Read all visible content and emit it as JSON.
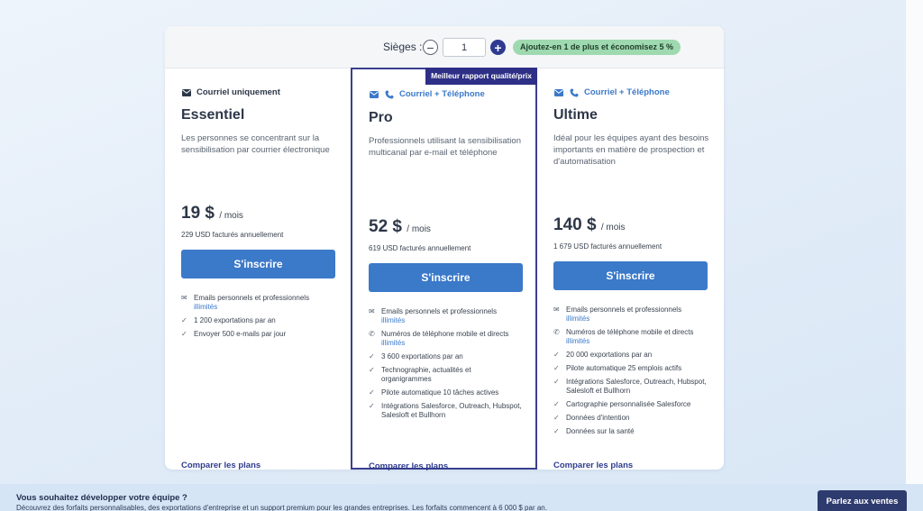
{
  "seats": {
    "label": "Sièges :",
    "value": "1",
    "minus": "−",
    "plus": "+",
    "badge": "Ajoutez-en 1 de plus et économisez 5 %"
  },
  "plans": [
    {
      "channel": "Courriel uniquement",
      "icons": [
        "envelope-icon"
      ],
      "name": "Essentiel",
      "description": "Les personnes se concentrant sur la sensibilisation par courrier électronique",
      "price": "19 $",
      "per": "/ mois",
      "billed": "229 USD facturés annuellement",
      "cta": "S'inscrire",
      "features": [
        {
          "icon": "envelope-icon",
          "text": "Emails personnels et professionnels",
          "highlight": "illimités"
        },
        {
          "icon": "check-icon",
          "text": "1 200 exportations par an",
          "highlight": ""
        },
        {
          "icon": "check-icon",
          "text": "Envoyer 500 e-mails par jour",
          "highlight": ""
        }
      ],
      "compare": "Comparer les plans"
    },
    {
      "ribbon": "Meilleur rapport qualité/prix",
      "channel": "Courriel + Téléphone",
      "icons": [
        "envelope-icon",
        "phone-icon"
      ],
      "name": "Pro",
      "description": "Professionnels utilisant la sensibilisation multicanal par e-mail et téléphone",
      "price": "52 $",
      "per": "/ mois",
      "billed": "619 USD facturés annuellement",
      "cta": "S'inscrire",
      "features": [
        {
          "icon": "envelope-icon",
          "text": "Emails personnels et professionnels",
          "highlight": "illimités"
        },
        {
          "icon": "phone-icon",
          "text": "Numéros de téléphone mobile et directs",
          "highlight": "illimités"
        },
        {
          "icon": "check-icon",
          "text": "3 600 exportations par an",
          "highlight": ""
        },
        {
          "icon": "check-icon",
          "text": "Technographie, actualités et organigrammes",
          "highlight": ""
        },
        {
          "icon": "check-icon",
          "text": "Pilote automatique 10 tâches actives",
          "highlight": ""
        },
        {
          "icon": "check-icon",
          "text": "Intégrations Salesforce, Outreach, Hubspot, Salesloft et Bullhorn",
          "highlight": ""
        }
      ],
      "compare": "Comparer les plans"
    },
    {
      "channel": "Courriel + Téléphone",
      "icons": [
        "envelope-icon",
        "phone-icon"
      ],
      "name": "Ultime",
      "description": "Idéal pour les équipes ayant des besoins importants en matière de prospection et d'automatisation",
      "price": "140 $",
      "per": "/ mois",
      "billed": "1 679 USD facturés annuellement",
      "cta": "S'inscrire",
      "features": [
        {
          "icon": "envelope-icon",
          "text": "Emails personnels et professionnels",
          "highlight": "illimités"
        },
        {
          "icon": "phone-icon",
          "text": "Numéros de téléphone mobile et directs",
          "highlight": "illimités"
        },
        {
          "icon": "check-icon",
          "text": "20 000 exportations par an",
          "highlight": ""
        },
        {
          "icon": "check-icon",
          "text": "Pilote automatique 25 emplois actifs",
          "highlight": ""
        },
        {
          "icon": "check-icon",
          "text": "Intégrations Salesforce, Outreach, Hubspot, Salesloft et Bullhorn",
          "highlight": ""
        },
        {
          "icon": "check-icon",
          "text": "Cartographie personnalisée Salesforce",
          "highlight": ""
        },
        {
          "icon": "check-icon",
          "text": "Données d'intention",
          "highlight": ""
        },
        {
          "icon": "check-icon",
          "text": "Données sur la santé",
          "highlight": ""
        }
      ],
      "compare": "Comparer les plans"
    }
  ],
  "banner": {
    "title": "Vous souhaitez développer votre équipe ?",
    "subtitle": "Découvrez des forfaits personnalisables, des exportations d'entreprise et un support premium pour les grandes entreprises. Les forfaits commencent à 6 000 $ par an.",
    "button": "Parlez aux ventes"
  },
  "colors": {
    "accent": "#3b79c9",
    "navy": "#2e3b8f",
    "badge_green": "#9fd9b0"
  }
}
